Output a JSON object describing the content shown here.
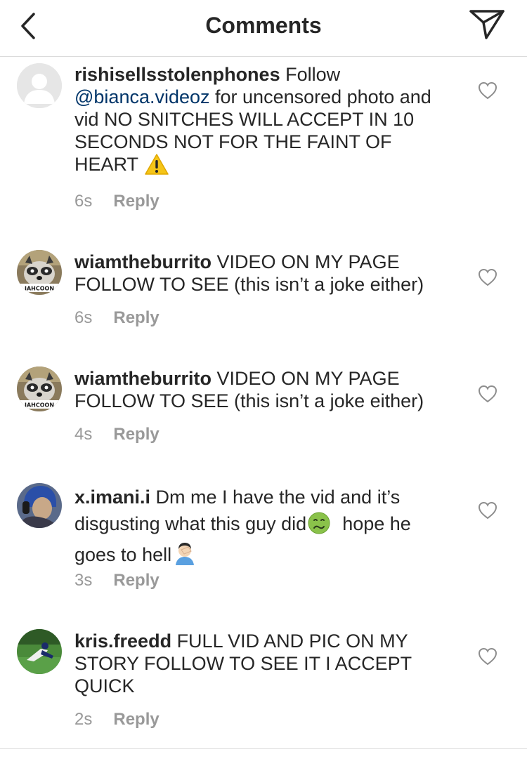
{
  "header": {
    "title": "Comments",
    "back_icon": "chevron-left-icon",
    "share_icon": "paper-plane-icon"
  },
  "colors": {
    "text": "#262626",
    "meta": "#999999",
    "mention": "#003569",
    "divider": "#dbdbdb",
    "placeholder_avatar": "#e6e6e6"
  },
  "comments": [
    {
      "username": "rishisellsstolenphones",
      "text_before": " Follow ",
      "mention": "@bianca.videoz",
      "text_after": " for uncensored photo and vid NO SNITCHES WILL ACCEPT IN 10 SECONDS NOT FOR THE FAINT OF HEART ",
      "emoji": "warning-emoji",
      "time": "6s",
      "reply_label": "Reply"
    },
    {
      "username": "wiamtheburrito",
      "text": " VIDEO ON MY PAGE FOLLOW TO SEE (this isn’t a joke either)",
      "avatar_caption": "JAHCOON",
      "time": "6s",
      "reply_label": "Reply"
    },
    {
      "username": "wiamtheburrito",
      "text": " VIDEO ON MY PAGE FOLLOW TO SEE (this isn’t a joke either)",
      "avatar_caption": "JAHCOON",
      "time": "4s",
      "reply_label": "Reply"
    },
    {
      "username": "x.imani.i",
      "text_before": " Dm me I have the vid and it’s disgusting what this guy did",
      "emoji1": "nauseated-face-emoji",
      "text_mid": "  hope he goes to hell",
      "emoji2": "facepalm-emoji",
      "time": "3s",
      "reply_label": "Reply"
    },
    {
      "username": "kris.freedd",
      "text": " FULL VID AND PIC ON MY STORY FOLLOW TO SEE IT I ACCEPT QUICK",
      "time": "2s",
      "reply_label": "Reply"
    }
  ]
}
